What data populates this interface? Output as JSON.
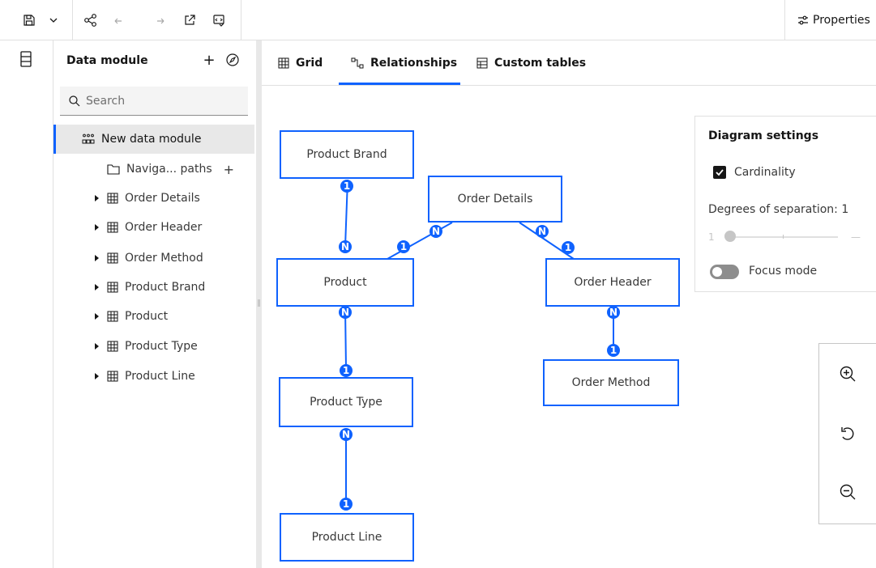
{
  "toolbar": {
    "properties_label": "Properties",
    "icons": [
      "save-icon",
      "chevron-down-icon",
      "share-icon",
      "undo-icon",
      "redo-icon",
      "launch-icon",
      "validate-icon",
      "settings-adjust-icon"
    ]
  },
  "panel": {
    "title": "Data module",
    "search_placeholder": "Search",
    "root_label": "New data module",
    "nav_paths_label": "Naviga... paths",
    "add_symbol": "+",
    "items": [
      {
        "label": "Order Details"
      },
      {
        "label": "Order Header"
      },
      {
        "label": "Order Method"
      },
      {
        "label": "Product Brand"
      },
      {
        "label": "Product"
      },
      {
        "label": "Product Type"
      },
      {
        "label": "Product Line"
      }
    ]
  },
  "tabs": [
    {
      "label": "Grid"
    },
    {
      "label": "Relationships",
      "active": true
    },
    {
      "label": "Custom tables"
    }
  ],
  "diagram": {
    "nodes": {
      "product_brand": "Product Brand",
      "order_details": "Order Details",
      "product": "Product",
      "order_header": "Order Header",
      "product_type": "Product Type",
      "order_method": "Order Method",
      "product_line": "Product Line"
    },
    "cardinality_one": "1",
    "cardinality_many": "N",
    "accent_color": "#0f62fe"
  },
  "settings": {
    "title": "Diagram settings",
    "cardinality_label": "Cardinality",
    "cardinality_checked": true,
    "degrees_label": "Degrees of separation: 1",
    "slider_min": "1",
    "slider_max": "—",
    "slider_value": 1,
    "focus_mode_label": "Focus mode",
    "focus_mode_on": false
  },
  "zoom": {
    "icons": [
      "zoom-in-icon",
      "reset-icon",
      "zoom-out-icon"
    ]
  }
}
